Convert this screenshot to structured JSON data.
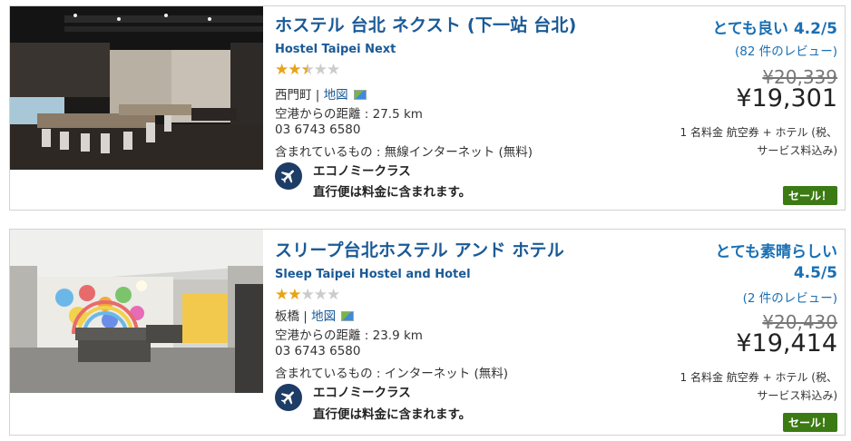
{
  "hotels": [
    {
      "name_ja": "ホステル 台北 ネクスト (下一站 台北)",
      "name_en": "Hostel Taipei Next",
      "stars_on": "★★",
      "stars_half": "★",
      "stars_off": "★★",
      "star_rating": 2.5,
      "area": "西門町",
      "separator": " | ",
      "map_label": "地図",
      "distance": "空港からの距離 : 27.5 km",
      "phone": "03 6743 6580",
      "included": "含まれているもの : 無線インターネット (無料)",
      "flight_class": "エコノミークラス",
      "flight_note": "直行便は料金に含まれます。",
      "rating_text": "とても良い 4.2/5",
      "reviews": "(82 件のレビュー)",
      "old_price": "¥20,339",
      "price": "¥19,301",
      "price_note_1": "1 名料金  航空券 + ホテル (税、",
      "price_note_2": "サービス料込み)",
      "sale": "セール！"
    },
    {
      "name_ja": "スリープ台北ホステル アンド ホテル",
      "name_en": "Sleep Taipei Hostel and Hotel",
      "stars_on": "★★",
      "stars_off": "★★★",
      "star_rating": 2,
      "area": "板橋",
      "separator": " | ",
      "map_label": "地図",
      "distance": "空港からの距離 : 23.9 km",
      "phone": "03 6743 6580",
      "included": "含まれているもの : インターネット (無料)",
      "flight_class": "エコノミークラス",
      "flight_note": "直行便は料金に含まれます。",
      "rating_line1": "とても素晴らしい",
      "rating_line2": "4.5/5",
      "reviews": "(2 件のレビュー)",
      "old_price": "¥20,430",
      "price": "¥19,414",
      "price_note_1": "1 名料金  航空券 + ホテル (税、",
      "price_note_2": "サービス料込み)",
      "sale": "セール！"
    }
  ],
  "colors": {
    "link": "#1a5a96",
    "rating": "#1a6fb3",
    "sale_bg": "#3c7a14",
    "star_on": "#e8a317",
    "plane_badge": "#1d3c66"
  },
  "icons": [
    "map-icon",
    "airplane-icon",
    "hotel-photo"
  ]
}
